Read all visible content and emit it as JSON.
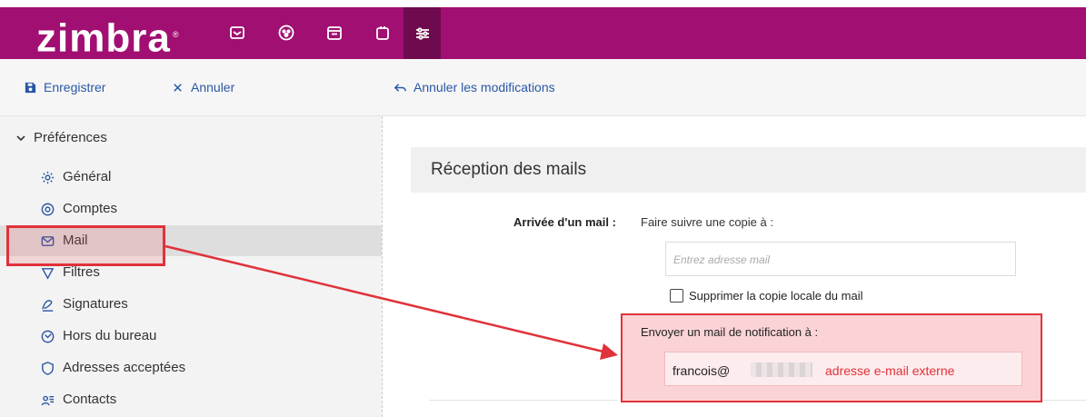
{
  "colors": {
    "brand": "#a10f72",
    "brand_dark": "#6e0a4d",
    "link": "#2a57a5",
    "annotation_red": "#e0323a"
  },
  "header": {
    "logo": "zimbra",
    "logo_mark": "®",
    "apps": [
      {
        "name": "mail-app-icon"
      },
      {
        "name": "contacts-app-icon"
      },
      {
        "name": "calendar-app-icon"
      },
      {
        "name": "tasks-app-icon"
      },
      {
        "name": "preferences-app-icon",
        "active": true
      }
    ]
  },
  "toolbar": {
    "save_label": "Enregistrer",
    "cancel_label": "Annuler",
    "undo_label": "Annuler les modifications"
  },
  "sidebar": {
    "header": "Préférences",
    "items": [
      {
        "label": "Général",
        "icon": "gear-icon"
      },
      {
        "label": "Comptes",
        "icon": "account-icon"
      },
      {
        "label": "Mail",
        "icon": "envelope-icon",
        "selected": true
      },
      {
        "label": "Filtres",
        "icon": "filter-icon"
      },
      {
        "label": "Signatures",
        "icon": "signature-icon"
      },
      {
        "label": "Hors du bureau",
        "icon": "out-of-office-icon"
      },
      {
        "label": "Adresses acceptées",
        "icon": "shield-icon"
      },
      {
        "label": "Contacts",
        "icon": "contacts-icon"
      }
    ]
  },
  "main": {
    "section_title": "Réception des mails",
    "arrival_label": "Arrivée d'un mail :",
    "forward_label": "Faire suivre une copie à :",
    "forward_placeholder": "Entrez adresse mail",
    "delete_local_label": "Supprimer la copie locale du mail",
    "notification_label": "Envoyer un mail de notification à :",
    "notification_value": "francois@",
    "annotation": "adresse e-mail externe"
  }
}
